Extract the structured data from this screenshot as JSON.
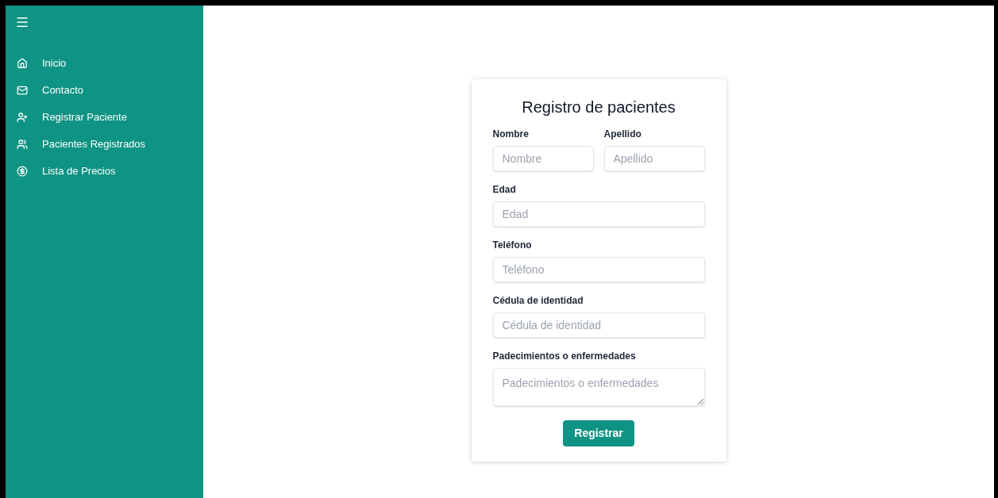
{
  "sidebar": {
    "items": [
      {
        "label": "Inicio"
      },
      {
        "label": "Contacto"
      },
      {
        "label": "Registrar Paciente"
      },
      {
        "label": "Pacientes Registrados"
      },
      {
        "label": "Lista de Precios"
      }
    ]
  },
  "form": {
    "title": "Registro de pacientes",
    "rows": [
      [
        {
          "label": "Nombre",
          "placeholder": "Nombre",
          "kind": "input"
        },
        {
          "label": "Apellido",
          "placeholder": "Apellido",
          "kind": "input"
        }
      ],
      [
        {
          "label": "Edad",
          "placeholder": "Edad",
          "kind": "input"
        }
      ],
      [
        {
          "label": "Teléfono",
          "placeholder": "Teléfono",
          "kind": "input"
        }
      ],
      [
        {
          "label": "Cédula de identidad",
          "placeholder": "Cédula de identidad",
          "kind": "input"
        }
      ],
      [
        {
          "label": "Padecimientos o enfermedades",
          "placeholder": "Padecimientos o enfermedades",
          "kind": "textarea"
        }
      ]
    ],
    "submit": "Registrar"
  }
}
